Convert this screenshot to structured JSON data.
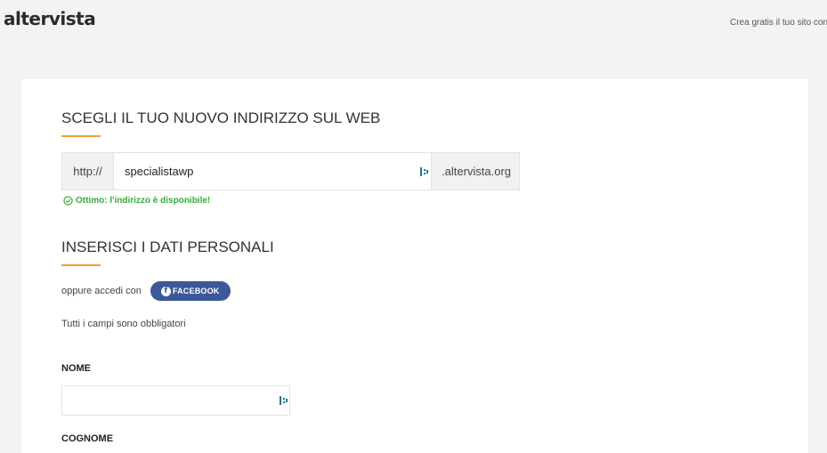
{
  "header": {
    "logo": "altervista",
    "tagline": "Crea gratis il tuo sito con A"
  },
  "address_section": {
    "title": "SCEGLI IL TUO NUOVO INDIRIZZO SUL WEB",
    "prefix": "http://",
    "value": "specialistawp",
    "suffix": ".altervista.org",
    "status": "Ottimo: l'indirizzo è disponibile!"
  },
  "personal_section": {
    "title": "INSERISCI I DATI PERSONALI",
    "or_login": "oppure accedi con",
    "facebook_label": "FACEBOOK",
    "facebook_letter": "f",
    "required_note": "Tutti i campi sono obbligatori",
    "name_label": "NOME",
    "name_value": "",
    "surname_label": "COGNOME"
  },
  "colors": {
    "accent": "#f0a030",
    "success": "#3aa83a",
    "facebook": "#3b5998"
  }
}
